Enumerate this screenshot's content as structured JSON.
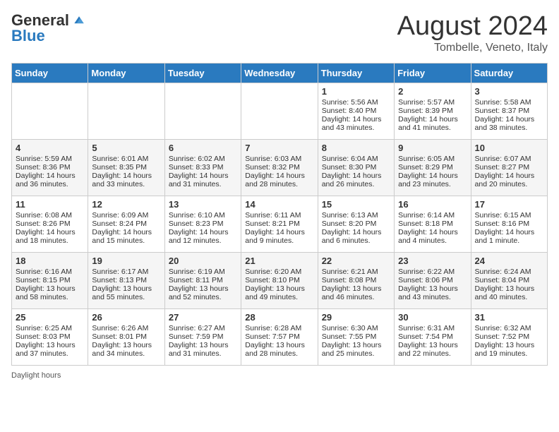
{
  "header": {
    "logo_general": "General",
    "logo_blue": "Blue",
    "title": "August 2024",
    "location": "Tombelle, Veneto, Italy"
  },
  "weekdays": [
    "Sunday",
    "Monday",
    "Tuesday",
    "Wednesday",
    "Thursday",
    "Friday",
    "Saturday"
  ],
  "footer": {
    "daylight_label": "Daylight hours"
  },
  "weeks": [
    [
      {
        "day": "",
        "sunrise": "",
        "sunset": "",
        "daylight": ""
      },
      {
        "day": "",
        "sunrise": "",
        "sunset": "",
        "daylight": ""
      },
      {
        "day": "",
        "sunrise": "",
        "sunset": "",
        "daylight": ""
      },
      {
        "day": "",
        "sunrise": "",
        "sunset": "",
        "daylight": ""
      },
      {
        "day": "1",
        "sunrise": "Sunrise: 5:56 AM",
        "sunset": "Sunset: 8:40 PM",
        "daylight": "Daylight: 14 hours and 43 minutes."
      },
      {
        "day": "2",
        "sunrise": "Sunrise: 5:57 AM",
        "sunset": "Sunset: 8:39 PM",
        "daylight": "Daylight: 14 hours and 41 minutes."
      },
      {
        "day": "3",
        "sunrise": "Sunrise: 5:58 AM",
        "sunset": "Sunset: 8:37 PM",
        "daylight": "Daylight: 14 hours and 38 minutes."
      }
    ],
    [
      {
        "day": "4",
        "sunrise": "Sunrise: 5:59 AM",
        "sunset": "Sunset: 8:36 PM",
        "daylight": "Daylight: 14 hours and 36 minutes."
      },
      {
        "day": "5",
        "sunrise": "Sunrise: 6:01 AM",
        "sunset": "Sunset: 8:35 PM",
        "daylight": "Daylight: 14 hours and 33 minutes."
      },
      {
        "day": "6",
        "sunrise": "Sunrise: 6:02 AM",
        "sunset": "Sunset: 8:33 PM",
        "daylight": "Daylight: 14 hours and 31 minutes."
      },
      {
        "day": "7",
        "sunrise": "Sunrise: 6:03 AM",
        "sunset": "Sunset: 8:32 PM",
        "daylight": "Daylight: 14 hours and 28 minutes."
      },
      {
        "day": "8",
        "sunrise": "Sunrise: 6:04 AM",
        "sunset": "Sunset: 8:30 PM",
        "daylight": "Daylight: 14 hours and 26 minutes."
      },
      {
        "day": "9",
        "sunrise": "Sunrise: 6:05 AM",
        "sunset": "Sunset: 8:29 PM",
        "daylight": "Daylight: 14 hours and 23 minutes."
      },
      {
        "day": "10",
        "sunrise": "Sunrise: 6:07 AM",
        "sunset": "Sunset: 8:27 PM",
        "daylight": "Daylight: 14 hours and 20 minutes."
      }
    ],
    [
      {
        "day": "11",
        "sunrise": "Sunrise: 6:08 AM",
        "sunset": "Sunset: 8:26 PM",
        "daylight": "Daylight: 14 hours and 18 minutes."
      },
      {
        "day": "12",
        "sunrise": "Sunrise: 6:09 AM",
        "sunset": "Sunset: 8:24 PM",
        "daylight": "Daylight: 14 hours and 15 minutes."
      },
      {
        "day": "13",
        "sunrise": "Sunrise: 6:10 AM",
        "sunset": "Sunset: 8:23 PM",
        "daylight": "Daylight: 14 hours and 12 minutes."
      },
      {
        "day": "14",
        "sunrise": "Sunrise: 6:11 AM",
        "sunset": "Sunset: 8:21 PM",
        "daylight": "Daylight: 14 hours and 9 minutes."
      },
      {
        "day": "15",
        "sunrise": "Sunrise: 6:13 AM",
        "sunset": "Sunset: 8:20 PM",
        "daylight": "Daylight: 14 hours and 6 minutes."
      },
      {
        "day": "16",
        "sunrise": "Sunrise: 6:14 AM",
        "sunset": "Sunset: 8:18 PM",
        "daylight": "Daylight: 14 hours and 4 minutes."
      },
      {
        "day": "17",
        "sunrise": "Sunrise: 6:15 AM",
        "sunset": "Sunset: 8:16 PM",
        "daylight": "Daylight: 14 hours and 1 minute."
      }
    ],
    [
      {
        "day": "18",
        "sunrise": "Sunrise: 6:16 AM",
        "sunset": "Sunset: 8:15 PM",
        "daylight": "Daylight: 13 hours and 58 minutes."
      },
      {
        "day": "19",
        "sunrise": "Sunrise: 6:17 AM",
        "sunset": "Sunset: 8:13 PM",
        "daylight": "Daylight: 13 hours and 55 minutes."
      },
      {
        "day": "20",
        "sunrise": "Sunrise: 6:19 AM",
        "sunset": "Sunset: 8:11 PM",
        "daylight": "Daylight: 13 hours and 52 minutes."
      },
      {
        "day": "21",
        "sunrise": "Sunrise: 6:20 AM",
        "sunset": "Sunset: 8:10 PM",
        "daylight": "Daylight: 13 hours and 49 minutes."
      },
      {
        "day": "22",
        "sunrise": "Sunrise: 6:21 AM",
        "sunset": "Sunset: 8:08 PM",
        "daylight": "Daylight: 13 hours and 46 minutes."
      },
      {
        "day": "23",
        "sunrise": "Sunrise: 6:22 AM",
        "sunset": "Sunset: 8:06 PM",
        "daylight": "Daylight: 13 hours and 43 minutes."
      },
      {
        "day": "24",
        "sunrise": "Sunrise: 6:24 AM",
        "sunset": "Sunset: 8:04 PM",
        "daylight": "Daylight: 13 hours and 40 minutes."
      }
    ],
    [
      {
        "day": "25",
        "sunrise": "Sunrise: 6:25 AM",
        "sunset": "Sunset: 8:03 PM",
        "daylight": "Daylight: 13 hours and 37 minutes."
      },
      {
        "day": "26",
        "sunrise": "Sunrise: 6:26 AM",
        "sunset": "Sunset: 8:01 PM",
        "daylight": "Daylight: 13 hours and 34 minutes."
      },
      {
        "day": "27",
        "sunrise": "Sunrise: 6:27 AM",
        "sunset": "Sunset: 7:59 PM",
        "daylight": "Daylight: 13 hours and 31 minutes."
      },
      {
        "day": "28",
        "sunrise": "Sunrise: 6:28 AM",
        "sunset": "Sunset: 7:57 PM",
        "daylight": "Daylight: 13 hours and 28 minutes."
      },
      {
        "day": "29",
        "sunrise": "Sunrise: 6:30 AM",
        "sunset": "Sunset: 7:55 PM",
        "daylight": "Daylight: 13 hours and 25 minutes."
      },
      {
        "day": "30",
        "sunrise": "Sunrise: 6:31 AM",
        "sunset": "Sunset: 7:54 PM",
        "daylight": "Daylight: 13 hours and 22 minutes."
      },
      {
        "day": "31",
        "sunrise": "Sunrise: 6:32 AM",
        "sunset": "Sunset: 7:52 PM",
        "daylight": "Daylight: 13 hours and 19 minutes."
      }
    ]
  ]
}
